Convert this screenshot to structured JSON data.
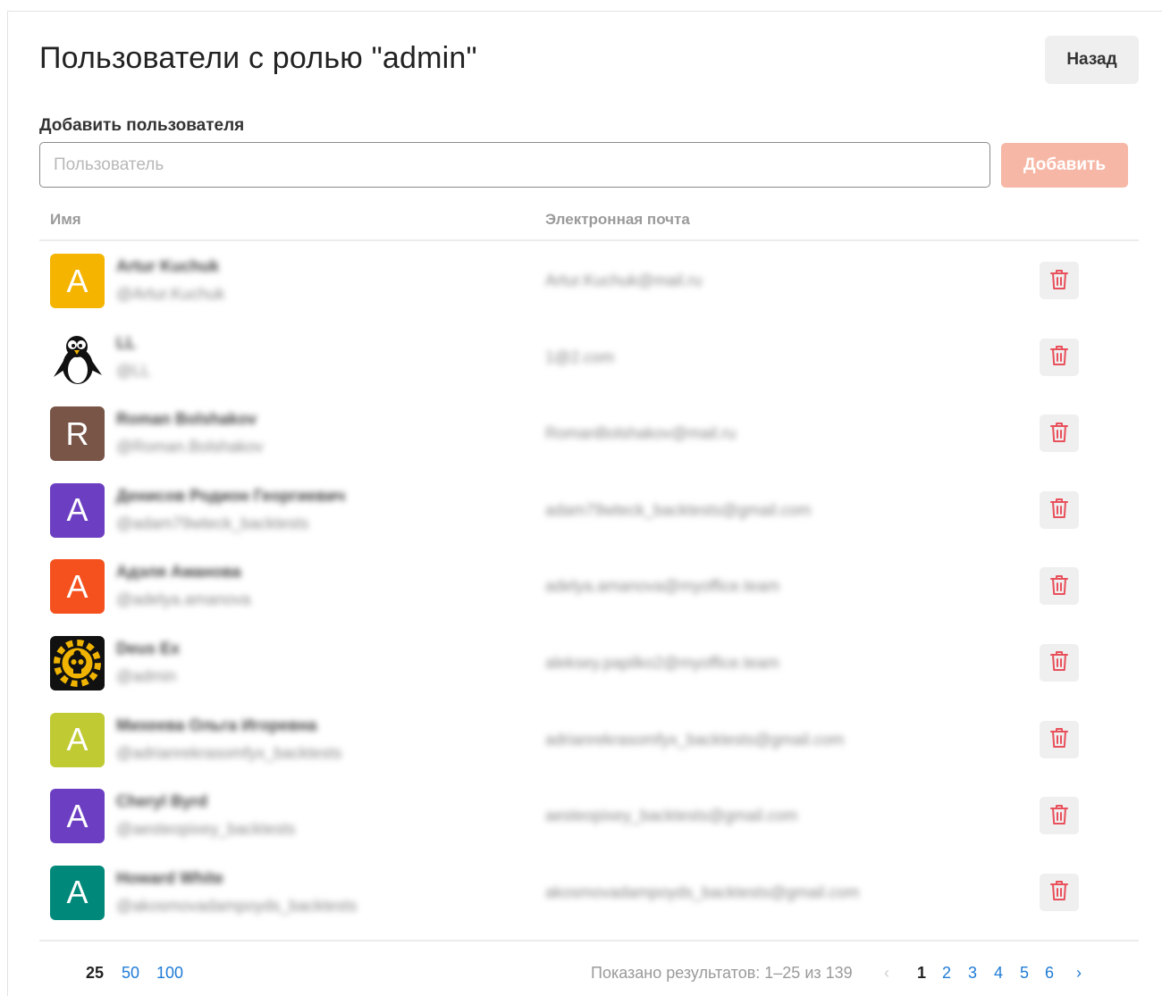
{
  "page": {
    "title": "Пользователи с ролью \"admin\"",
    "back_label": "Назад"
  },
  "add_user": {
    "label": "Добавить пользователя",
    "placeholder": "Пользователь",
    "value": "",
    "button_label": "Добавить"
  },
  "table": {
    "col_name": "Имя",
    "col_email": "Электронная почта",
    "rows": [
      {
        "initial": "A",
        "avatar_color": "#f5b400",
        "avatar_type": "letter",
        "name": "Artur Kuchuk",
        "login": "@Artur.Kuchuk",
        "email": "Artur.Kuchuk@mail.ru"
      },
      {
        "initial": "",
        "avatar_color": "#ffffff",
        "avatar_type": "penguin-image",
        "name": "LL",
        "login": "@LL",
        "email": "1@2.com"
      },
      {
        "initial": "R",
        "avatar_color": "#795548",
        "avatar_type": "letter",
        "name": "Roman Bolshakov",
        "login": "@Roman.Bolshakov",
        "email": "RomanBolshakov@mail.ru"
      },
      {
        "initial": "A",
        "avatar_color": "#6c3fc2",
        "avatar_type": "letter",
        "name": "Денисов Родион Георгиевич",
        "login": "@adam79wteck_backtests",
        "email": "adam79wteck_backtests@gmail.com"
      },
      {
        "initial": "A",
        "avatar_color": "#f4511e",
        "avatar_type": "letter",
        "name": "Адэля Аманова",
        "login": "@adelya.amanova",
        "email": "adelya.amanova@myoffice.team"
      },
      {
        "initial": "",
        "avatar_color": "#111111",
        "avatar_type": "skull-gear-image",
        "name": "Deus Ex",
        "login": "@admin",
        "email": "aleksey.papilko2@myoffice.team"
      },
      {
        "initial": "A",
        "avatar_color": "#c0ca33",
        "avatar_type": "letter",
        "name": "Михеева Ольга Игоревна",
        "login": "@adrianrekrasomfyx_backtests",
        "email": "adrianrekrasomfyx_backtests@gmail.com"
      },
      {
        "initial": "A",
        "avatar_color": "#6c3fc2",
        "avatar_type": "letter",
        "name": "Cheryl Byrd",
        "login": "@aesteopixey_backtests",
        "email": "aesteopixey_backtests@gmail.com"
      },
      {
        "initial": "A",
        "avatar_color": "#00897b",
        "avatar_type": "letter",
        "name": "Howard White",
        "login": "@akosmovadampoyds_backtests",
        "email": "akosmovadampoyds_backtests@gmail.com"
      }
    ]
  },
  "footer": {
    "per_page": [
      "25",
      "50",
      "100"
    ],
    "per_page_selected": "25",
    "results_text": "Показано результатов: 1–25 из 139",
    "prev_icon": "chevron-left-icon",
    "pages": [
      "1",
      "2",
      "3",
      "4",
      "5",
      "6"
    ],
    "current_page": "1",
    "next_icon": "chevron-right-icon"
  },
  "colors": {
    "accent_link": "#1e7bd6",
    "add_button_disabled": "#f6b7a6",
    "delete_icon": "#e8505b"
  }
}
